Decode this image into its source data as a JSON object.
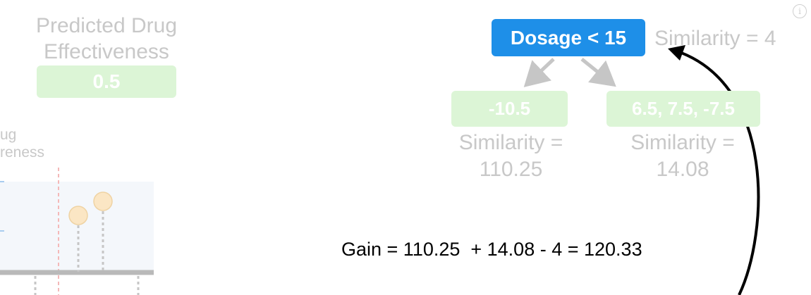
{
  "left_panel": {
    "title_line1": "Predicted Drug",
    "title_line2": "Effectiveness",
    "prediction_value": "0.5",
    "axis_label_line1": "ug",
    "axis_label_line2": "reness"
  },
  "tree": {
    "root_label": "Dosage < 15",
    "root_similarity": "Similarity = 4",
    "left_leaf": {
      "residuals": "-10.5",
      "similarity_line1": "Similarity =",
      "similarity_line2": "110.25"
    },
    "right_leaf": {
      "residuals": "6.5, 7.5, -7.5",
      "similarity_line1": "Similarity =",
      "similarity_line2": "14.08"
    }
  },
  "gain_equation": "Gain = 110.25  + 14.08 - 4 = 120.33",
  "icons": {
    "info": "info-icon",
    "info_glyph": "i"
  },
  "colors": {
    "root_node": "#1e8fe8",
    "leaf_box": "#dcf5d6",
    "faded_text": "#c8c8c8",
    "arrow": "#000000",
    "point_fill": "#fbe6c4"
  }
}
